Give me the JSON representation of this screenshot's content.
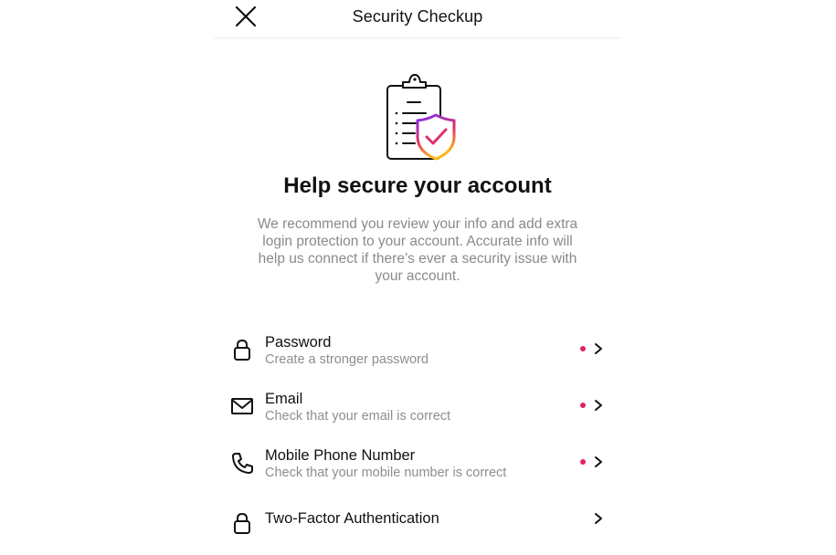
{
  "header": {
    "title": "Security Checkup"
  },
  "icons": {
    "close": "close-icon",
    "illustration": "clipboard-shield-icon",
    "chevron": "chevron-right-icon"
  },
  "colors": {
    "alert_dot": "#e0245e",
    "secondary_text": "#8e8e8e",
    "shield_gradient": [
      "#7b2ff7",
      "#e1306c",
      "#fdb913"
    ]
  },
  "main": {
    "headline": "Help secure your account",
    "intro": "We recommend you review your info and add extra login protection to your account. Accurate info will help us connect if there’s ever a security issue with your account."
  },
  "items": [
    {
      "icon": "lock-icon",
      "title": "Password",
      "subtitle": "Create a stronger password",
      "alert": true
    },
    {
      "icon": "mail-icon",
      "title": "Email",
      "subtitle": "Check that your email is correct",
      "alert": true
    },
    {
      "icon": "phone-icon",
      "title": "Mobile Phone Number",
      "subtitle": "Check that your mobile number is correct",
      "alert": true
    },
    {
      "icon": "lock-icon",
      "title": "Two-Factor Authentication",
      "subtitle": "",
      "alert": false
    }
  ]
}
